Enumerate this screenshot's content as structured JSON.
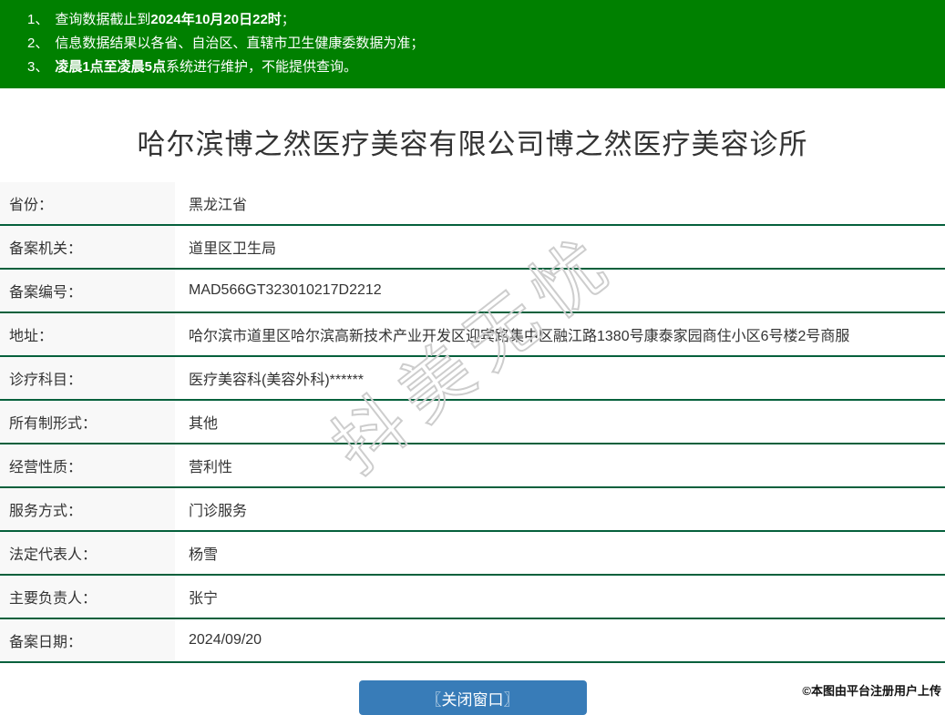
{
  "notice": {
    "background_color": "#008000",
    "items": [
      {
        "num": "1、",
        "pre": "查询数据截止到",
        "bold": "2024年10月20日22时",
        "post": "；"
      },
      {
        "num": "2、",
        "pre": "信息数据结果以各省、自治区、直辖市卫生健康委数据为准；",
        "bold": "",
        "post": ""
      },
      {
        "num": "3、",
        "pre": "",
        "bold": "凌晨1点至凌晨5点",
        "post": "系统进行维护，不能提供查询。"
      }
    ]
  },
  "title": "哈尔滨博之然医疗美容有限公司博之然医疗美容诊所",
  "table": {
    "border_color": "#05603c",
    "label_background": "#f8f8f8",
    "rows": [
      {
        "label": "省份：",
        "value": "黑龙江省"
      },
      {
        "label": "备案机关：",
        "value": "道里区卫生局"
      },
      {
        "label": "备案编号：",
        "value": "MAD566GT323010217D2212"
      },
      {
        "label": "地址：",
        "value": "哈尔滨市道里区哈尔滨高新技术产业开发区迎宾路集中区融江路1380号康泰家园商住小区6号楼2号商服"
      },
      {
        "label": "诊疗科目：",
        "value": "医疗美容科(美容外科)******"
      },
      {
        "label": "所有制形式：",
        "value": "其他"
      },
      {
        "label": "经营性质：",
        "value": "营利性"
      },
      {
        "label": "服务方式：",
        "value": "门诊服务"
      },
      {
        "label": "法定代表人：",
        "value": "杨雪"
      },
      {
        "label": "主要负责人：",
        "value": "张宁"
      },
      {
        "label": "备案日期：",
        "value": "2024/09/20"
      }
    ]
  },
  "close_button": {
    "label": "〖关闭窗口〗",
    "color": "#387cb8"
  },
  "watermark": {
    "text": "抖美无忧"
  },
  "footer": {
    "copyright": "©本图由平台注册用户上传"
  }
}
